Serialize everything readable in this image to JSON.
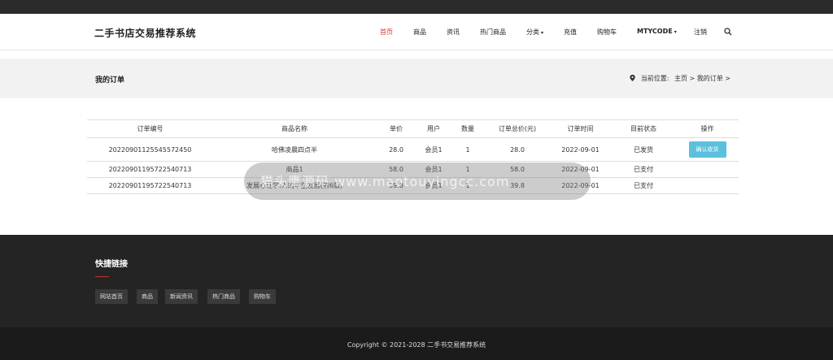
{
  "header": {
    "brand": "二手书店交易推荐系统",
    "nav": [
      {
        "label": "首页",
        "active": true
      },
      {
        "label": "商品"
      },
      {
        "label": "资讯"
      },
      {
        "label": "热门商品"
      },
      {
        "label": "分类",
        "caret": "▾"
      },
      {
        "label": "充值"
      },
      {
        "label": "购物车"
      },
      {
        "label": "MTYCODE",
        "caret": "▾"
      },
      {
        "label": "注销"
      }
    ],
    "search_icon": "search-icon"
  },
  "banner": {
    "title": "我的订单",
    "breadcrumb_prefix": "当前位置:",
    "crumb_home": "主页",
    "crumb_sep": ">",
    "crumb_current": "我的订单",
    "crumb_trail": ">"
  },
  "orders": {
    "columns": [
      "订单编号",
      "商品名称",
      "单价",
      "用户",
      "数量",
      "订单总价(元)",
      "订单时间",
      "目前状态",
      "操作"
    ],
    "rows": [
      {
        "id": "20220901125545572450",
        "name": "哈佛凌晨四点半",
        "price": "28.0",
        "user": "会员1",
        "qty": "1",
        "total": "28.0",
        "time": "2022-09-01",
        "status": "已发货",
        "action": "确认收货"
      },
      {
        "id": "20220901195722540713",
        "name": "商品1",
        "price": "58.0",
        "user": "会员1",
        "qty": "1",
        "total": "58.0",
        "time": "2022-09-01",
        "status": "已支付",
        "action": ""
      },
      {
        "id": "20220901195722540713",
        "name": "发展心理学:人的毕生发展(第6版)",
        "price": "39.8",
        "user": "会员1",
        "qty": "1",
        "total": "39.8",
        "time": "2022-09-01",
        "status": "已支付",
        "action": ""
      }
    ]
  },
  "watermark": "猫头鹰源码 www.maotouyingcc.com",
  "footer": {
    "title": "快捷链接",
    "links": [
      "网站首页",
      "商品",
      "新闻资讯",
      "热门商品",
      "购物车"
    ],
    "copyright": "Copyright © 2021-2028 二手书交易推荐系统"
  },
  "colors": {
    "topbar": "#2b2b2b",
    "active_nav": "#dd3333",
    "banner_bg": "#f2f2f2",
    "button": "#5bc0de",
    "footer_bg": "#242424",
    "copyright_bg": "#1b1b1b",
    "accent_line": "#c0392b"
  }
}
